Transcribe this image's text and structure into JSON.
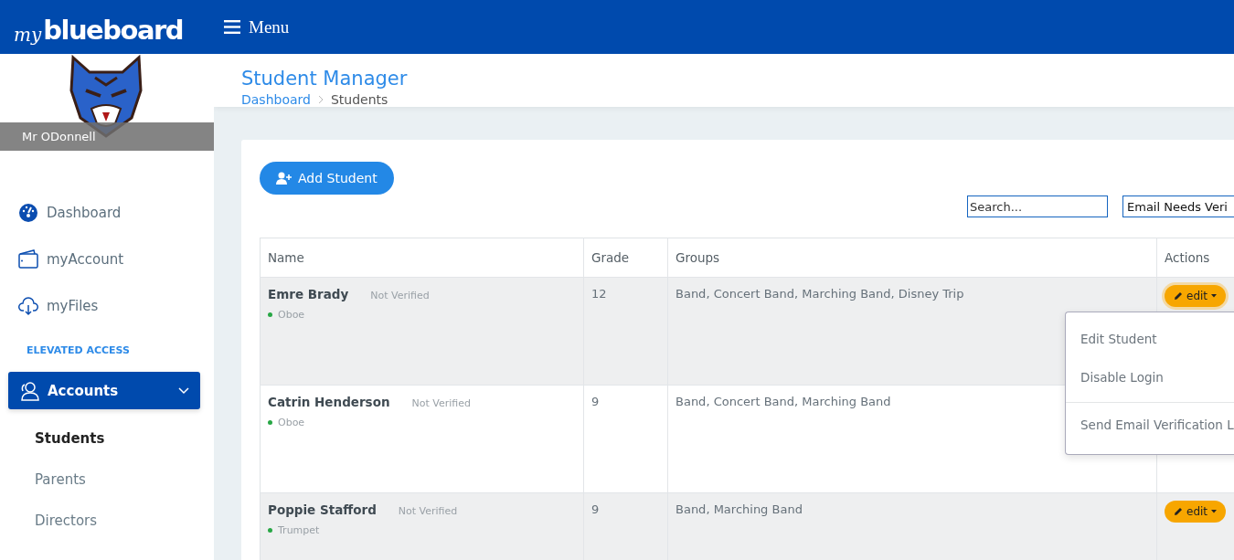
{
  "topbar": {
    "logo": {
      "script": "my",
      "word": "blueboard"
    },
    "menu_label": "Menu"
  },
  "sidebar": {
    "user_name": "Mr ODonnell",
    "items": [
      {
        "label": "Dashboard",
        "selected": false
      },
      {
        "label": "myAccount",
        "selected": false
      },
      {
        "label": "myFiles",
        "selected": false
      }
    ],
    "section_label": "ELEVATED ACCESS",
    "group": {
      "label": "Accounts",
      "expanded": true,
      "selected": true,
      "children": [
        {
          "label": "Students",
          "selected": true
        },
        {
          "label": "Parents",
          "selected": false
        },
        {
          "label": "Directors",
          "selected": false
        }
      ]
    }
  },
  "page": {
    "title": "Student Manager",
    "breadcrumb": [
      {
        "label": "Dashboard",
        "link": true
      },
      {
        "label": "Students",
        "link": false
      }
    ]
  },
  "toolbar": {
    "add_button": "Add Student",
    "search": {
      "placeholder": "Search..."
    },
    "filter": {
      "value": "Email Needs Veri"
    }
  },
  "table": {
    "columns": [
      "Name",
      "Grade",
      "Groups",
      "Actions"
    ],
    "rows": [
      {
        "name": "Emre Brady",
        "status": "Not Verified",
        "instrument": "Oboe",
        "grade": "12",
        "groups": "Band, Concert Band, Marching Band, Disney Trip",
        "action": {
          "label": "edit",
          "focused": true
        }
      },
      {
        "name": "Catrin Henderson",
        "status": "Not Verified",
        "instrument": "Oboe",
        "grade": "9",
        "groups": "Band, Concert Band, Marching Band"
      },
      {
        "name": "Poppie Stafford",
        "status": "Not Verified",
        "instrument": "Trumpet",
        "grade": "9",
        "groups": "Band, Marching Band",
        "action": {
          "label": "edit",
          "focused": false
        }
      }
    ]
  },
  "actions_menu": {
    "items": [
      {
        "label": "Edit Student",
        "divider_before": false
      },
      {
        "label": "Disable Login",
        "divider_before": false
      },
      {
        "label": "Send Email Verification L",
        "divider_before": true
      }
    ]
  }
}
